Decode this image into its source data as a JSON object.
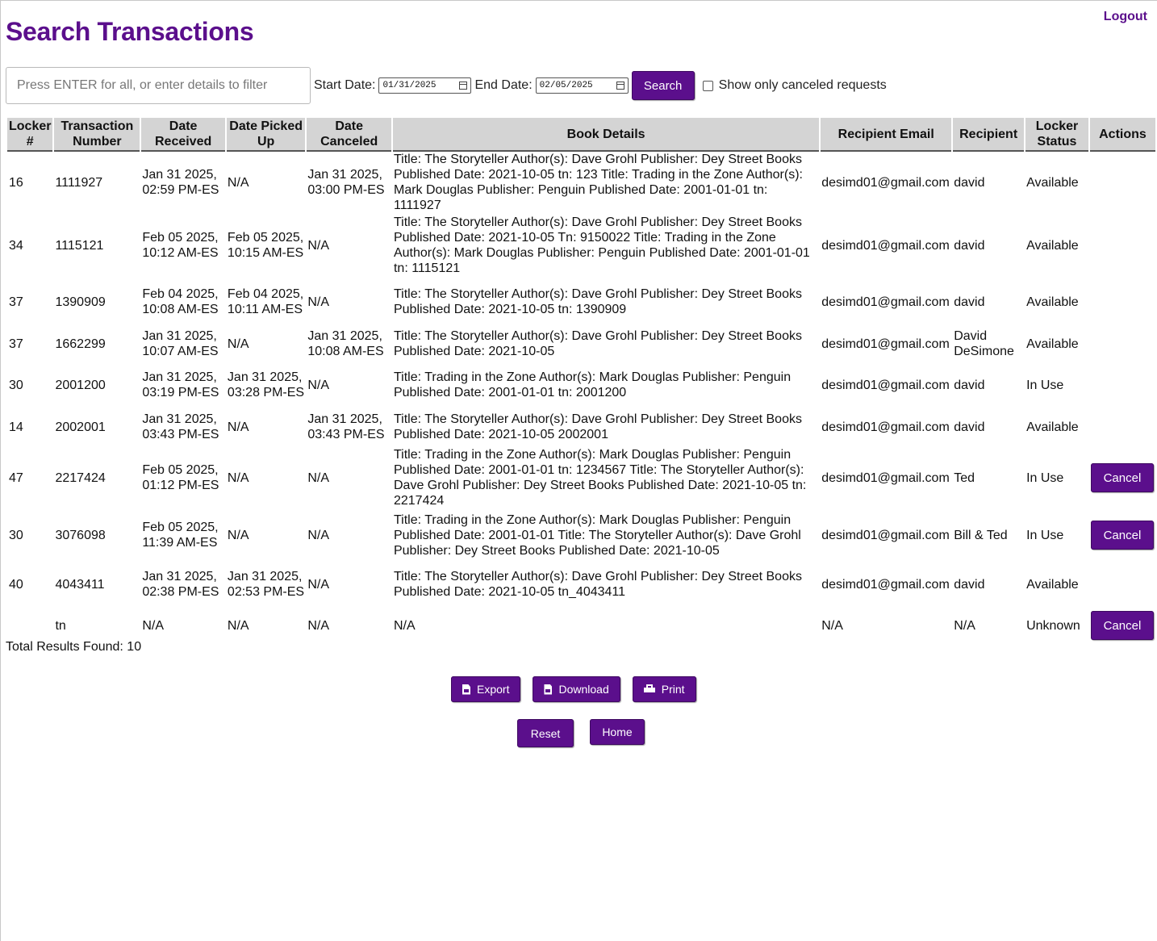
{
  "header": {
    "title": "Search Transactions",
    "logout_label": "Logout"
  },
  "filters": {
    "search_placeholder": "Press ENTER for all, or enter details to filter",
    "start_label": "Start Date:",
    "start_value": "01/31/2025",
    "end_label": "End Date:",
    "end_value": "02/05/2025",
    "search_label": "Search",
    "canceled_label": "Show only canceled requests"
  },
  "table": {
    "headers": {
      "locker": "Locker #",
      "transaction": "Transaction Number",
      "received": "Date Received",
      "picked": "Date Picked Up",
      "canceled": "Date Canceled",
      "book": "Book Details",
      "email": "Recipient Email",
      "recipient": "Recipient",
      "status": "Locker Status",
      "actions": "Actions"
    },
    "cancel_label": "Cancel",
    "rows": [
      {
        "locker": "16",
        "tn": "1111927",
        "received": "Jan 31 2025, 02:59 PM-ES",
        "picked": "N/A",
        "canceled": "Jan 31 2025, 03:00 PM-ES",
        "book": "Title: The Storyteller Author(s): Dave Grohl Publisher: Dey Street Books Published Date: 2021-10-05 tn: 123 Title: Trading in the Zone Author(s): Mark Douglas Publisher: Penguin Published Date: 2001-01-01 tn: 1111927",
        "email": "desimd01@gmail.com",
        "recipient": "david",
        "status": "Available",
        "cancel": false
      },
      {
        "locker": "34",
        "tn": "1115121",
        "received": "Feb 05 2025, 10:12 AM-ES",
        "picked": "Feb 05 2025, 10:15 AM-ES",
        "canceled": "N/A",
        "book": "Title: The Storyteller Author(s): Dave Grohl Publisher: Dey Street Books Published Date: 2021-10-05 Tn: 9150022 Title: Trading in the Zone Author(s): Mark Douglas Publisher: Penguin Published Date: 2001-01-01 tn: 1115121",
        "email": "desimd01@gmail.com",
        "recipient": "david",
        "status": "Available",
        "cancel": false
      },
      {
        "locker": "37",
        "tn": "1390909",
        "received": "Feb 04 2025, 10:08 AM-ES",
        "picked": "Feb 04 2025, 10:11 AM-ES",
        "canceled": "N/A",
        "book": "Title: The Storyteller Author(s): Dave Grohl Publisher: Dey Street Books Published Date: 2021-10-05 tn: 1390909",
        "email": "desimd01@gmail.com",
        "recipient": "david",
        "status": "Available",
        "cancel": false
      },
      {
        "locker": "37",
        "tn": "1662299",
        "received": "Jan 31 2025, 10:07 AM-ES",
        "picked": "N/A",
        "canceled": "Jan 31 2025, 10:08 AM-ES",
        "book": "Title: The Storyteller Author(s): Dave Grohl Publisher: Dey Street Books Published Date: 2021-10-05",
        "email": "desimd01@gmail.com",
        "recipient": "David DeSimone",
        "status": "Available",
        "cancel": false
      },
      {
        "locker": "30",
        "tn": "2001200",
        "received": "Jan 31 2025, 03:19 PM-ES",
        "picked": "Jan 31 2025, 03:28 PM-ES",
        "canceled": "N/A",
        "book": "Title: Trading in the Zone Author(s): Mark Douglas Publisher: Penguin Published Date: 2001-01-01 tn: 2001200",
        "email": "desimd01@gmail.com",
        "recipient": "david",
        "status": "In Use",
        "cancel": false
      },
      {
        "locker": "14",
        "tn": "2002001",
        "received": "Jan 31 2025, 03:43 PM-ES",
        "picked": "N/A",
        "canceled": "Jan 31 2025, 03:43 PM-ES",
        "book": "Title: The Storyteller Author(s): Dave Grohl Publisher: Dey Street Books Published Date: 2021-10-05 2002001",
        "email": "desimd01@gmail.com",
        "recipient": "david",
        "status": "Available",
        "cancel": false
      },
      {
        "locker": "47",
        "tn": "2217424",
        "received": "Feb 05 2025, 01:12 PM-ES",
        "picked": "N/A",
        "canceled": "N/A",
        "book": "Title: Trading in the Zone Author(s): Mark Douglas Publisher: Penguin Published Date: 2001-01-01 tn: 1234567 Title: The Storyteller Author(s): Dave Grohl Publisher: Dey Street Books Published Date: 2021-10-05 tn: 2217424",
        "email": "desimd01@gmail.com",
        "recipient": "Ted",
        "status": "In Use",
        "cancel": true
      },
      {
        "locker": "30",
        "tn": "3076098",
        "received": "Feb 05 2025, 11:39 AM-ES",
        "picked": "N/A",
        "canceled": "N/A",
        "book": "Title: Trading in the Zone Author(s): Mark Douglas Publisher: Penguin Published Date: 2001-01-01 Title: The Storyteller Author(s): Dave Grohl Publisher: Dey Street Books Published Date: 2021-10-05",
        "email": "desimd01@gmail.com",
        "recipient": "Bill & Ted",
        "status": "In Use",
        "cancel": true
      },
      {
        "locker": "40",
        "tn": "4043411",
        "received": "Jan 31 2025, 02:38 PM-ES",
        "picked": "Jan 31 2025, 02:53 PM-ES",
        "canceled": "N/A",
        "book": "Title: The Storyteller Author(s): Dave Grohl Publisher: Dey Street Books Published Date: 2021-10-05 tn_4043411",
        "email": "desimd01@gmail.com",
        "recipient": "david",
        "status": "Available",
        "cancel": false
      },
      {
        "locker": "",
        "tn": "tn",
        "received": "N/A",
        "picked": "N/A",
        "canceled": "N/A",
        "book": "N/A",
        "email": "N/A",
        "recipient": "N/A",
        "status": "Unknown",
        "cancel": true
      }
    ]
  },
  "footer": {
    "total_text": "Total Results Found: 10",
    "export_label": "Export",
    "download_label": "Download",
    "print_label": "Print",
    "reset_label": "Reset",
    "home_label": "Home"
  },
  "colors": {
    "accent": "#5b0f8c",
    "header_bg": "#d4d4d4"
  }
}
